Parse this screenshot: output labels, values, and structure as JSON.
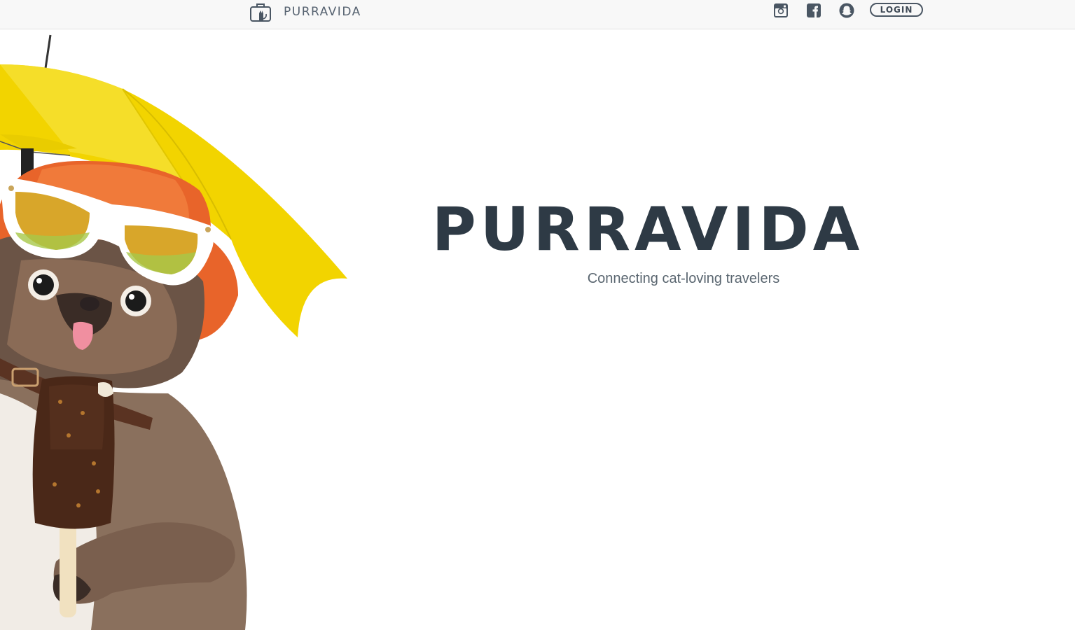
{
  "nav": {
    "brand": "PURRAVIDA",
    "logo_icon": "suitcase-cat-icon",
    "social": [
      {
        "name": "instagram",
        "icon": "instagram-icon"
      },
      {
        "name": "facebook",
        "icon": "facebook-icon"
      },
      {
        "name": "snapchat",
        "icon": "snapchat-icon"
      }
    ],
    "login_label": "LOGIN"
  },
  "hero": {
    "title": "PURRAVIDA",
    "subtitle": "Connecting cat-loving travelers",
    "image_icon": "cat-with-umbrella-illustration"
  },
  "colors": {
    "title": "#2e3a45",
    "nav_bg": "#f8f8f8",
    "umbrella": "#f2d400",
    "hat": "#e8642a"
  }
}
